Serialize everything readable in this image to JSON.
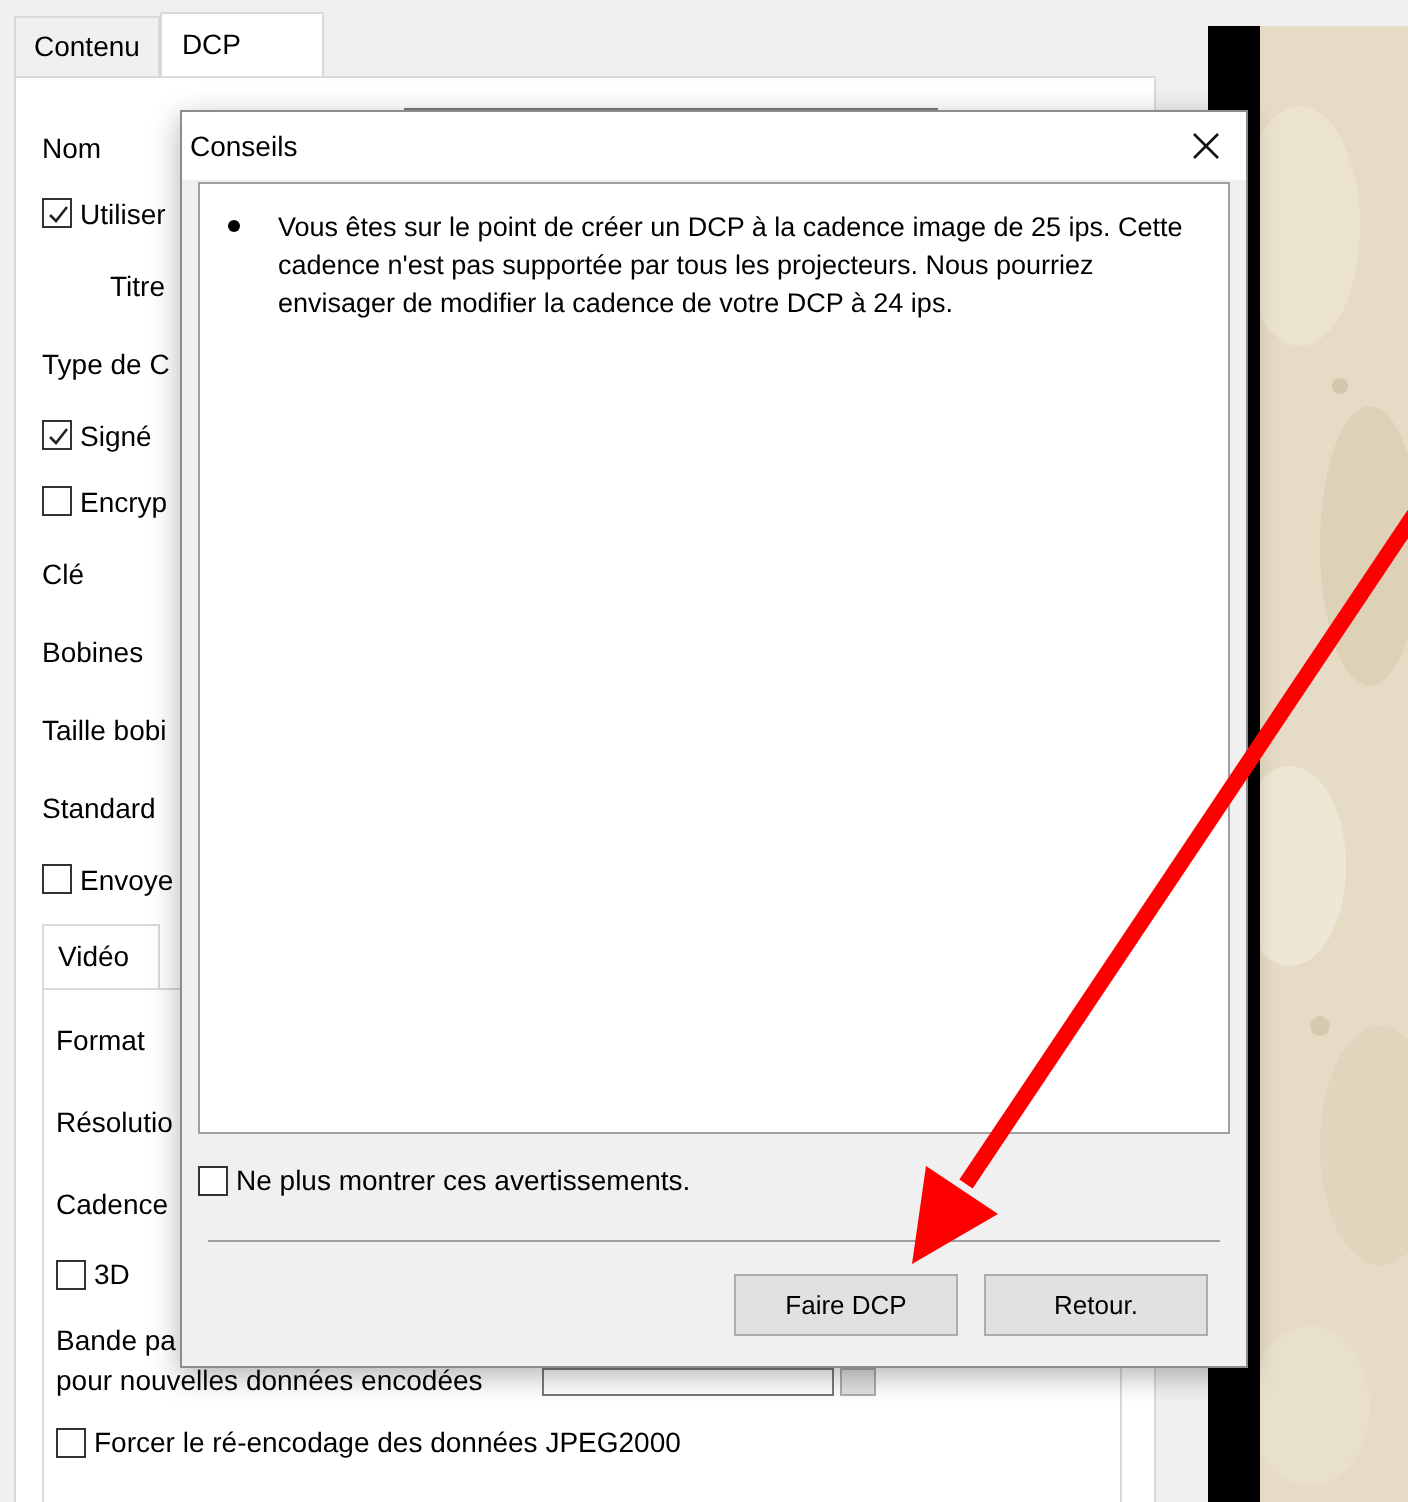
{
  "settings_window": {
    "tabs": [
      {
        "label": "Contenu",
        "selected": false
      },
      {
        "label": "DCP",
        "selected": true
      }
    ],
    "rows": [
      {
        "kind": "field",
        "text": "Nom"
      },
      {
        "kind": "checkbox",
        "text": "Utiliser",
        "checked": true
      },
      {
        "kind": "indented",
        "text": "Titre"
      },
      {
        "kind": "label",
        "text": "Type de C"
      },
      {
        "kind": "checkbox",
        "text": "Signé",
        "checked": true
      },
      {
        "kind": "checkbox",
        "text": "Encryp",
        "checked": false
      },
      {
        "kind": "label",
        "text": "Clé"
      },
      {
        "kind": "label",
        "text": "Bobines"
      },
      {
        "kind": "label",
        "text": "Taille bobi"
      },
      {
        "kind": "label",
        "text": "Standard"
      },
      {
        "kind": "checkbox",
        "text": "Envoye",
        "checked": false
      }
    ],
    "video_tabs": [
      {
        "label": "Vidéo",
        "selected": true
      }
    ],
    "video_rows": [
      {
        "kind": "label",
        "text": "Format"
      },
      {
        "kind": "label",
        "text": "Résolutio"
      },
      {
        "kind": "label",
        "text": "Cadence"
      },
      {
        "kind": "checkbox",
        "text": "3D",
        "checked": false
      },
      {
        "kind": "wrapped",
        "lines": [
          "Bande pa",
          "pour nouvelles données encodées"
        ]
      },
      {
        "kind": "checkbox",
        "text": "Forcer le ré-encodage des données JPEG2000",
        "checked": false
      }
    ]
  },
  "dialog": {
    "title": "Conseils",
    "messages": [
      "Vous êtes sur le point de créer un DCP à la cadence image de 25 ips. Cette cadence n'est pas supportée par tous les projecteurs. Nous pourriez envisager de modifier la cadence de votre DCP à 24 ips."
    ],
    "dont_show": {
      "label": "Ne plus montrer ces avertissements.",
      "checked": false
    },
    "buttons": [
      "Faire DCP",
      "Retour."
    ]
  }
}
